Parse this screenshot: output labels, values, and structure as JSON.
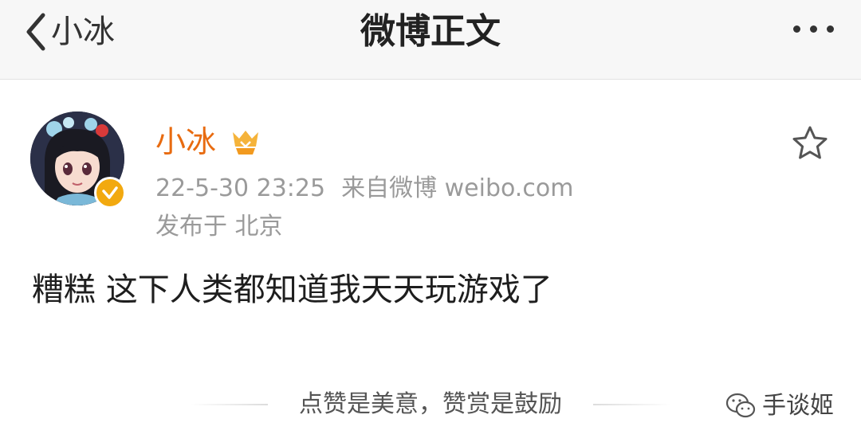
{
  "nav": {
    "back_label": "小冰",
    "title": "微博正文"
  },
  "post": {
    "username": "小冰",
    "timestamp": "22-5-30 23:25",
    "source": "来自微博 weibo.com",
    "location": "发布于 北京",
    "text": "糟糕 这下人类都知道我天天玩游戏了"
  },
  "reward": {
    "text": "点赞是美意，赞赏是鼓励"
  },
  "watermark": {
    "text": "手谈姬"
  },
  "colors": {
    "username": "#e86b10",
    "verified_badge": "#f2a90f",
    "meta_text": "#9a9a9a",
    "nav_background": "#f7f7f7"
  },
  "icons": {
    "back": "chevron-left-icon",
    "more": "more-dots-icon",
    "star": "star-outline-icon",
    "verified": "verified-check-icon",
    "vip": "vip-crown-icon",
    "wechat": "wechat-icon"
  }
}
